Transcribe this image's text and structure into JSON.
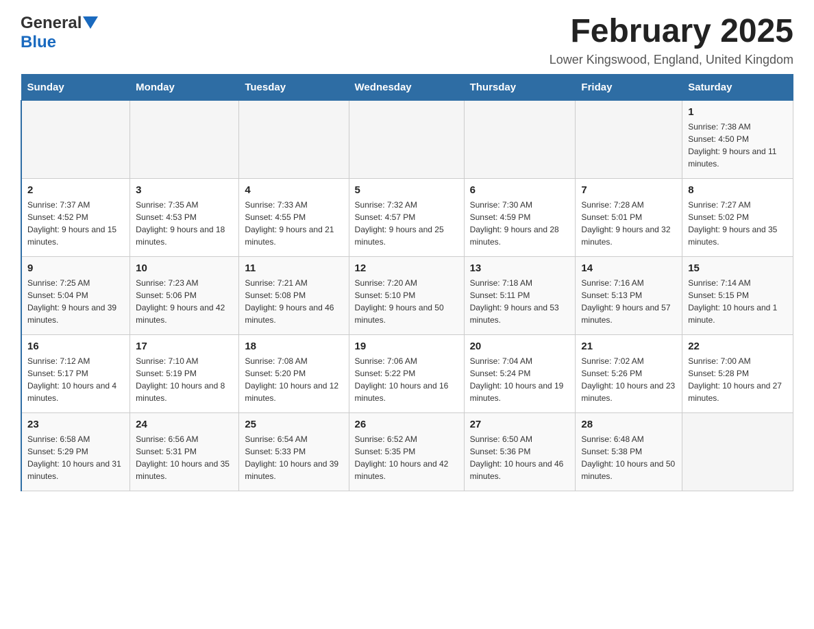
{
  "header": {
    "logo": {
      "general": "General",
      "blue": "Blue",
      "arrow": "▲"
    },
    "title": "February 2025",
    "location": "Lower Kingswood, England, United Kingdom"
  },
  "days_of_week": [
    "Sunday",
    "Monday",
    "Tuesday",
    "Wednesday",
    "Thursday",
    "Friday",
    "Saturday"
  ],
  "weeks": [
    [
      {
        "day": "",
        "info": ""
      },
      {
        "day": "",
        "info": ""
      },
      {
        "day": "",
        "info": ""
      },
      {
        "day": "",
        "info": ""
      },
      {
        "day": "",
        "info": ""
      },
      {
        "day": "",
        "info": ""
      },
      {
        "day": "1",
        "info": "Sunrise: 7:38 AM\nSunset: 4:50 PM\nDaylight: 9 hours and 11 minutes."
      }
    ],
    [
      {
        "day": "2",
        "info": "Sunrise: 7:37 AM\nSunset: 4:52 PM\nDaylight: 9 hours and 15 minutes."
      },
      {
        "day": "3",
        "info": "Sunrise: 7:35 AM\nSunset: 4:53 PM\nDaylight: 9 hours and 18 minutes."
      },
      {
        "day": "4",
        "info": "Sunrise: 7:33 AM\nSunset: 4:55 PM\nDaylight: 9 hours and 21 minutes."
      },
      {
        "day": "5",
        "info": "Sunrise: 7:32 AM\nSunset: 4:57 PM\nDaylight: 9 hours and 25 minutes."
      },
      {
        "day": "6",
        "info": "Sunrise: 7:30 AM\nSunset: 4:59 PM\nDaylight: 9 hours and 28 minutes."
      },
      {
        "day": "7",
        "info": "Sunrise: 7:28 AM\nSunset: 5:01 PM\nDaylight: 9 hours and 32 minutes."
      },
      {
        "day": "8",
        "info": "Sunrise: 7:27 AM\nSunset: 5:02 PM\nDaylight: 9 hours and 35 minutes."
      }
    ],
    [
      {
        "day": "9",
        "info": "Sunrise: 7:25 AM\nSunset: 5:04 PM\nDaylight: 9 hours and 39 minutes."
      },
      {
        "day": "10",
        "info": "Sunrise: 7:23 AM\nSunset: 5:06 PM\nDaylight: 9 hours and 42 minutes."
      },
      {
        "day": "11",
        "info": "Sunrise: 7:21 AM\nSunset: 5:08 PM\nDaylight: 9 hours and 46 minutes."
      },
      {
        "day": "12",
        "info": "Sunrise: 7:20 AM\nSunset: 5:10 PM\nDaylight: 9 hours and 50 minutes."
      },
      {
        "day": "13",
        "info": "Sunrise: 7:18 AM\nSunset: 5:11 PM\nDaylight: 9 hours and 53 minutes."
      },
      {
        "day": "14",
        "info": "Sunrise: 7:16 AM\nSunset: 5:13 PM\nDaylight: 9 hours and 57 minutes."
      },
      {
        "day": "15",
        "info": "Sunrise: 7:14 AM\nSunset: 5:15 PM\nDaylight: 10 hours and 1 minute."
      }
    ],
    [
      {
        "day": "16",
        "info": "Sunrise: 7:12 AM\nSunset: 5:17 PM\nDaylight: 10 hours and 4 minutes."
      },
      {
        "day": "17",
        "info": "Sunrise: 7:10 AM\nSunset: 5:19 PM\nDaylight: 10 hours and 8 minutes."
      },
      {
        "day": "18",
        "info": "Sunrise: 7:08 AM\nSunset: 5:20 PM\nDaylight: 10 hours and 12 minutes."
      },
      {
        "day": "19",
        "info": "Sunrise: 7:06 AM\nSunset: 5:22 PM\nDaylight: 10 hours and 16 minutes."
      },
      {
        "day": "20",
        "info": "Sunrise: 7:04 AM\nSunset: 5:24 PM\nDaylight: 10 hours and 19 minutes."
      },
      {
        "day": "21",
        "info": "Sunrise: 7:02 AM\nSunset: 5:26 PM\nDaylight: 10 hours and 23 minutes."
      },
      {
        "day": "22",
        "info": "Sunrise: 7:00 AM\nSunset: 5:28 PM\nDaylight: 10 hours and 27 minutes."
      }
    ],
    [
      {
        "day": "23",
        "info": "Sunrise: 6:58 AM\nSunset: 5:29 PM\nDaylight: 10 hours and 31 minutes."
      },
      {
        "day": "24",
        "info": "Sunrise: 6:56 AM\nSunset: 5:31 PM\nDaylight: 10 hours and 35 minutes."
      },
      {
        "day": "25",
        "info": "Sunrise: 6:54 AM\nSunset: 5:33 PM\nDaylight: 10 hours and 39 minutes."
      },
      {
        "day": "26",
        "info": "Sunrise: 6:52 AM\nSunset: 5:35 PM\nDaylight: 10 hours and 42 minutes."
      },
      {
        "day": "27",
        "info": "Sunrise: 6:50 AM\nSunset: 5:36 PM\nDaylight: 10 hours and 46 minutes."
      },
      {
        "day": "28",
        "info": "Sunrise: 6:48 AM\nSunset: 5:38 PM\nDaylight: 10 hours and 50 minutes."
      },
      {
        "day": "",
        "info": ""
      }
    ]
  ]
}
